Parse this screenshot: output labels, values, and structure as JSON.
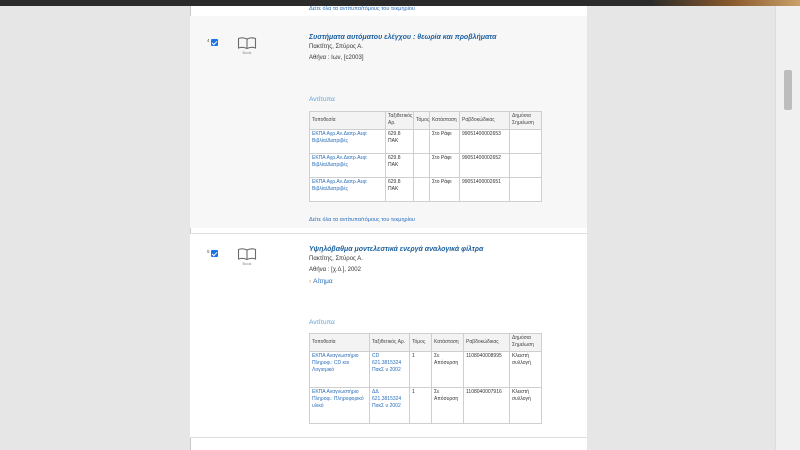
{
  "top_link": "Δείτε όλα τα αντίτυπα/τόμους του τεκμηρίου",
  "records": [
    {
      "number": "4",
      "type_label": "Book",
      "title": "Συστήματα αυτόματου ελέγχου : θεωρία και προβλήματα",
      "author": "Πακτίτης, Σπύρος Α.",
      "publication": "Αθήνα : Ιων, [c2003]",
      "section_label": "Αντίτυπα",
      "columns": [
        "Τοποθεσία",
        "Ταξιθετικός Αρ.",
        "Τόμος",
        "Κατάσταση",
        "Ραβδοκώδικας",
        "Δημόσια Σημείωση"
      ],
      "rows": [
        {
          "location": "ΕΚΠΑ Αγρ.Αν.Διατρ.Αεφ: Βιβλία/Διατριβές",
          "call_number": "629.8 ΠΑΚ",
          "volume": "",
          "status": "Στο Ράφι",
          "barcode": "99051400002653",
          "note": ""
        },
        {
          "location": "ΕΚΠΑ Αγρ.Αν.Διατρ.Αεφ: Βιβλία/Διατριβές",
          "call_number": "629.8 ΠΑΚ",
          "volume": "",
          "status": "Στο Ράφι",
          "barcode": "99051400002652",
          "note": ""
        },
        {
          "location": "ΕΚΠΑ Αγρ.Αν.Διατρ.Αεφ: Βιβλία/Διατριβές",
          "call_number": "629.8 ΠΑΚ",
          "volume": "",
          "status": "Στο Ράφι",
          "barcode": "99051400002651",
          "note": ""
        }
      ],
      "all_items_link": "Δείτε όλα τα αντίτυπα/τόμους του τεκμηρίου"
    },
    {
      "number": "5",
      "type_label": "Book",
      "title": "Υψηλόβαθμα μοντελεστικά ενεργά αναλογικά φίλτρα",
      "author": "Πακτίτης, Σπύρος Α.",
      "publication": "Αθήνα : [χ.ό.], 2002",
      "request_link": "Αίτημα",
      "section_label": "Αντίτυπα",
      "columns": [
        "Τοποθεσία",
        "Ταξιθετικός Αρ.",
        "Τόμος",
        "Κατάσταση",
        "Ραβδοκώδικας",
        "Δημόσια Σημείωση"
      ],
      "rows": [
        {
          "location": "ΕΚΠΑ Αναγνωστήριο Πληροφ.: CD και Λογισμικό",
          "call_number": "CD 621.3815324 ΠακΣ υ 2002",
          "volume": "1",
          "status": "Σε Απόσυρση",
          "barcode": "1108040008995",
          "note": "Κλειστή συλλογή"
        },
        {
          "location": "ΕΚΠΑ Αναγνωστήριο Πληροφ.: Πληροφορικό υλικό",
          "call_number": "ΔΔ 621.3815324 ΠακΣ υ 2002",
          "volume": "1",
          "status": "Σε Απόσυρση",
          "barcode": "1108040007916",
          "note": "Κλειστή συλλογή"
        }
      ]
    }
  ]
}
